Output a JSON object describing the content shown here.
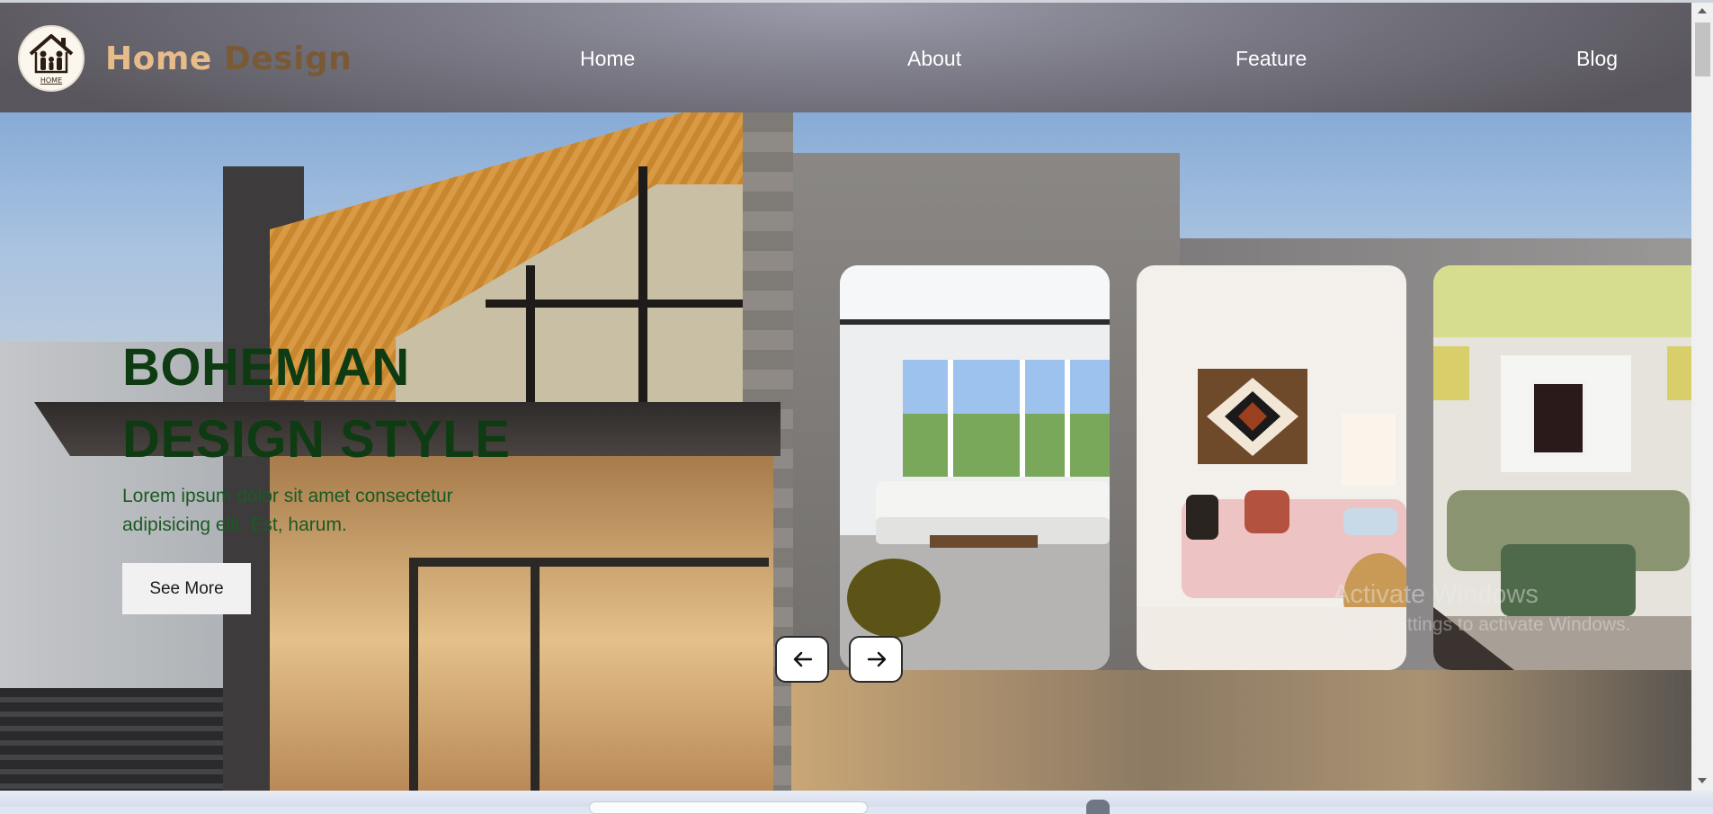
{
  "brand": {
    "home": "Home",
    "design": "Design",
    "logo_caption": "HOME"
  },
  "nav": {
    "home": "Home",
    "about": "About",
    "feature": "Feature",
    "blog": "Blog"
  },
  "hero": {
    "title_line1": "BOHEMIAN",
    "title_line2": "DESIGN STYLE",
    "description": "Lorem ipsum dolor sit amet consectetur adipisicing elit. Est, harum.",
    "button_label": "See More"
  },
  "slider": {
    "cards": [
      "living-room-white-sofa",
      "living-room-pink-sofa",
      "living-room-green-sofa"
    ],
    "prev_icon": "arrow-left-icon",
    "next_icon": "arrow-right-icon"
  },
  "watermark": {
    "title": "Activate Windows",
    "subtitle": "Go to Settings to activate Windows."
  },
  "colors": {
    "title_green": "#0e3b12",
    "brand_light": "#e7bc8a",
    "brand_dark": "#7a5a35",
    "header_bg": "#7b7a86"
  }
}
